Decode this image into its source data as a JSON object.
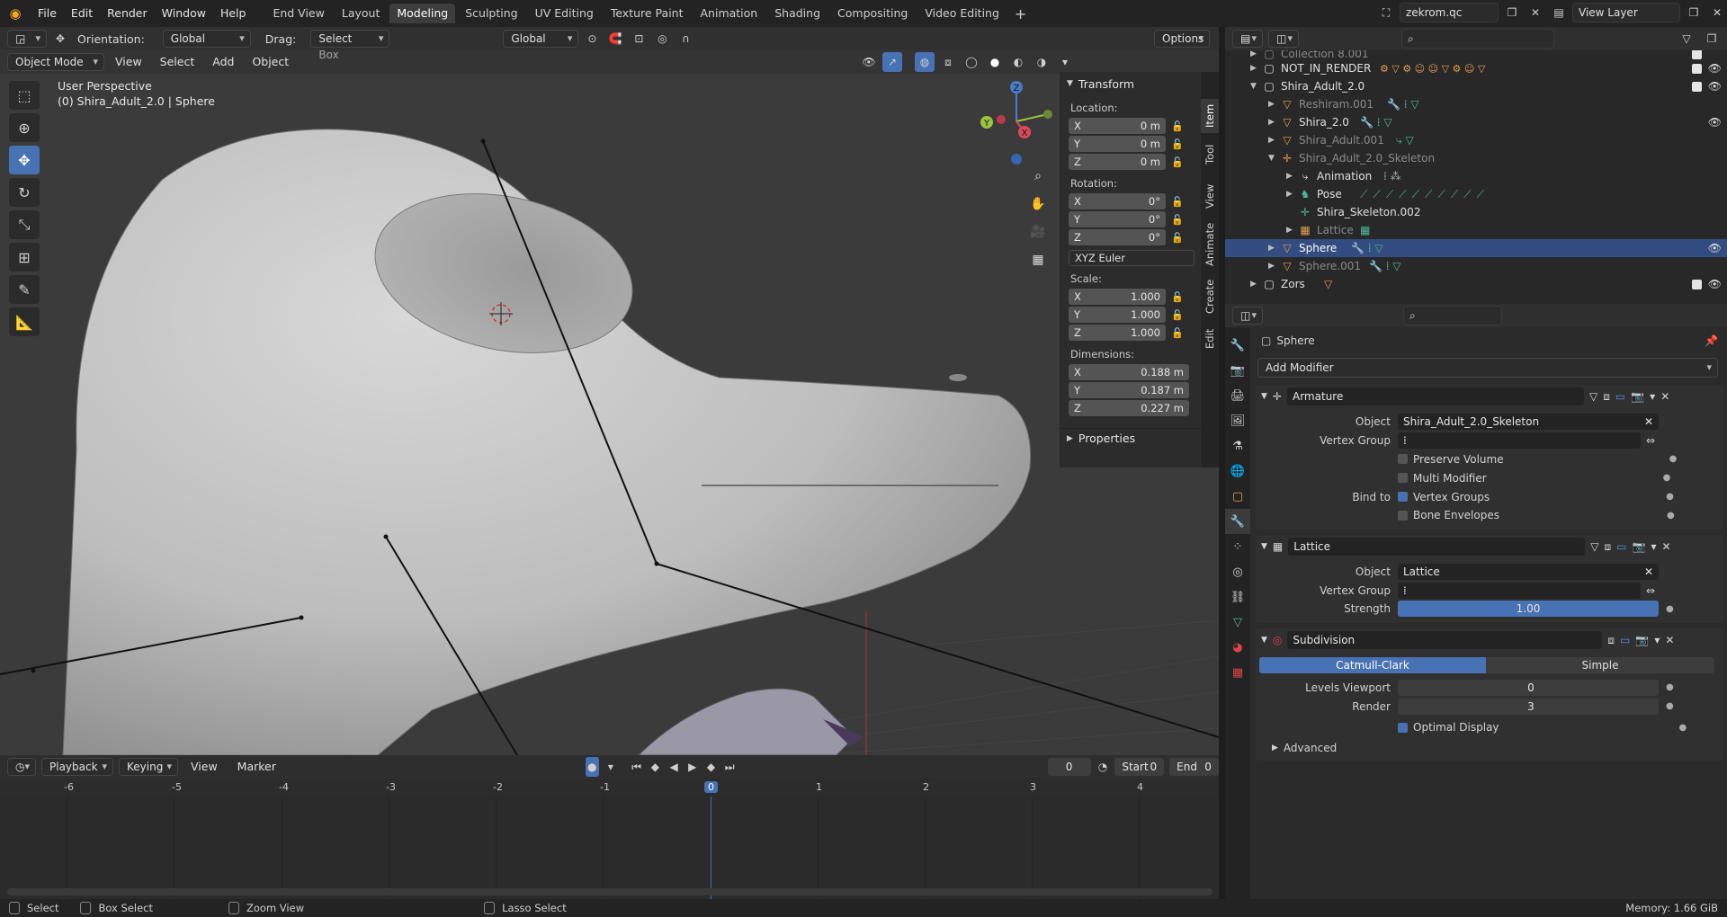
{
  "topbar": {
    "menus": [
      "File",
      "Edit",
      "Render",
      "Window",
      "Help"
    ],
    "workspaces": [
      "End View",
      "Layout",
      "Modeling",
      "Sculpting",
      "UV Editing",
      "Texture Paint",
      "Animation",
      "Shading",
      "Compositing",
      "Video Editing"
    ],
    "active_workspace": "Modeling",
    "scene_name": "zekrom.qc",
    "view_layer": "View Layer"
  },
  "viewport": {
    "orientation_label": "Orientation:",
    "orientation_value": "Global",
    "drag_label": "Drag:",
    "drag_value": "Select Box",
    "pivot_value": "Global",
    "options_label": "Options",
    "mode": "Object Mode",
    "menus": [
      "View",
      "Select",
      "Add",
      "Object"
    ],
    "perspective": "User Perspective",
    "object_info": "(0) Shira_Adult_2.0 | Sphere",
    "gizmo": {
      "x": "X",
      "y": "Y",
      "z": "Z"
    }
  },
  "npanel": {
    "tabs": [
      "Item",
      "Tool",
      "View",
      "Animate",
      "Create",
      "Edit"
    ],
    "transform_title": "Transform",
    "location_label": "Location:",
    "location": [
      {
        "axis": "X",
        "value": "0 m"
      },
      {
        "axis": "Y",
        "value": "0 m"
      },
      {
        "axis": "Z",
        "value": "0 m"
      }
    ],
    "rotation_label": "Rotation:",
    "rotation": [
      {
        "axis": "X",
        "value": "0°"
      },
      {
        "axis": "Y",
        "value": "0°"
      },
      {
        "axis": "Z",
        "value": "0°"
      }
    ],
    "rotation_mode": "XYZ Euler",
    "scale_label": "Scale:",
    "scale": [
      {
        "axis": "X",
        "value": "1.000"
      },
      {
        "axis": "Y",
        "value": "1.000"
      },
      {
        "axis": "Z",
        "value": "1.000"
      }
    ],
    "dimensions_label": "Dimensions:",
    "dimensions": [
      {
        "axis": "X",
        "value": "0.188 m"
      },
      {
        "axis": "Y",
        "value": "0.187 m"
      },
      {
        "axis": "Z",
        "value": "0.227 m"
      }
    ],
    "properties_title": "Properties"
  },
  "timeline": {
    "menus": [
      "Playback",
      "Keying",
      "View",
      "Marker"
    ],
    "current_frame": "0",
    "start_label": "Start",
    "start": "0",
    "end_label": "End",
    "end": "0",
    "ticks": [
      "-6",
      "-5",
      "-4",
      "-3",
      "-2",
      "-1",
      "0",
      "1",
      "2",
      "3",
      "4"
    ]
  },
  "statusbar": {
    "select": "Select",
    "box_select": "Box Select",
    "zoom_view": "Zoom View",
    "lasso_select": "Lasso Select",
    "memory": "Memory: 1.66 GiB"
  },
  "outliner": {
    "items": [
      {
        "name": "Collection 8.001",
        "dim": true
      },
      {
        "name": "NOT_IN_RENDER",
        "dim": false
      },
      {
        "name": "Shira_Adult_2.0",
        "dim": false
      },
      {
        "name": "Reshiram.001",
        "dim": true
      },
      {
        "name": "Shira_2.0",
        "dim": false
      },
      {
        "name": "Shira_Adult.001",
        "dim": true
      },
      {
        "name": "Shira_Adult_2.0_Skeleton",
        "dim": true
      },
      {
        "name": "Animation",
        "dim": false
      },
      {
        "name": "Pose",
        "dim": false
      },
      {
        "name": "Shira_Skeleton.002",
        "dim": false
      },
      {
        "name": "Lattice",
        "dim": true
      },
      {
        "name": "Sphere",
        "dim": false
      },
      {
        "name": "Sphere.001",
        "dim": true
      },
      {
        "name": "Zors",
        "dim": false
      }
    ]
  },
  "properties": {
    "object_name": "Sphere",
    "add_modifier": "Add Modifier",
    "armature": {
      "name": "Armature",
      "object_label": "Object",
      "object_value": "Shira_Adult_2.0_Skeleton",
      "vgroup_label": "Vertex Group",
      "preserve_volume": "Preserve Volume",
      "multi_modifier": "Multi Modifier",
      "bind_to_label": "Bind to",
      "vertex_groups": "Vertex Groups",
      "bone_envelopes": "Bone Envelopes"
    },
    "lattice": {
      "name": "Lattice",
      "object_label": "Object",
      "object_value": "Lattice",
      "vgroup_label": "Vertex Group",
      "strength_label": "Strength",
      "strength_value": "1.00",
      "strength_fraction": 1.0
    },
    "subdivision": {
      "name": "Subdivision",
      "mode_a": "Catmull-Clark",
      "mode_b": "Simple",
      "levels_label": "Levels Viewport",
      "levels_value": "0",
      "render_label": "Render",
      "render_value": "3",
      "optimal_display": "Optimal Display",
      "advanced": "Advanced"
    }
  },
  "colors": {
    "accent": "#4772b3",
    "selection": "#334d80",
    "background": "#393939"
  }
}
